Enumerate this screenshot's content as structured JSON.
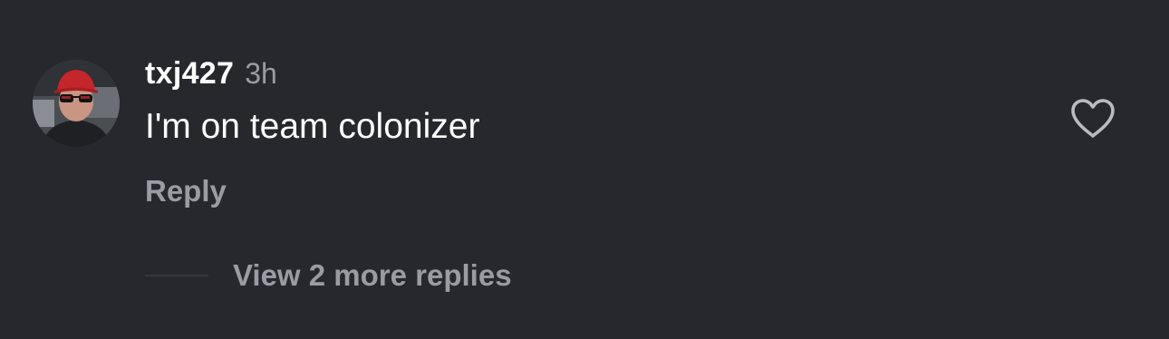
{
  "comment": {
    "username": "txj427",
    "timestamp": "3h",
    "text": "I'm on team colonizer",
    "reply_label": "Reply",
    "view_replies_label": "View 2 more replies",
    "avatar_icon": "profile-photo-icon",
    "like_icon": "heart-outline-icon"
  },
  "colors": {
    "background": "#26282d",
    "primary_text": "#ffffff",
    "secondary_text": "#9a9ca3",
    "divider": "#34363c"
  }
}
